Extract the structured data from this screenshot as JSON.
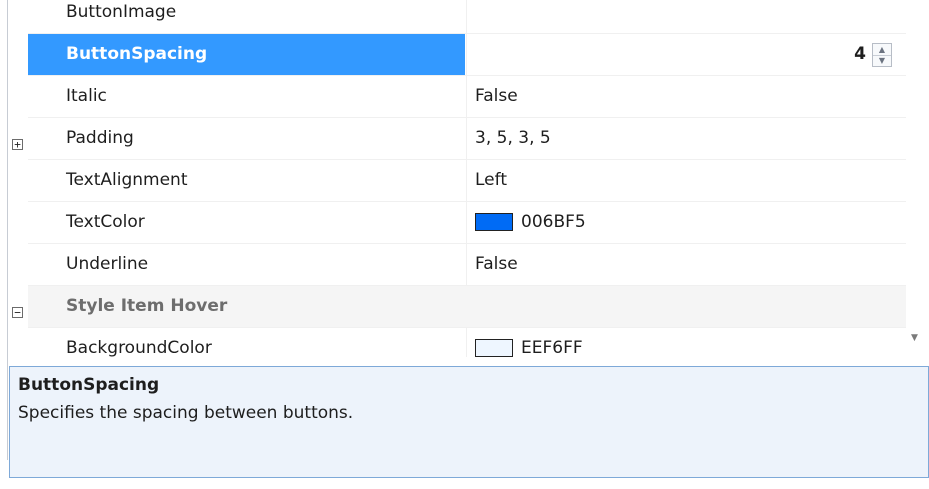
{
  "properties": {
    "rows": [
      {
        "name": "ButtonImage",
        "value": ""
      },
      {
        "name": "ButtonSpacing",
        "value": "4"
      },
      {
        "name": "Italic",
        "value": "False"
      },
      {
        "name": "Padding",
        "value": "3, 5, 3, 5"
      },
      {
        "name": "TextAlignment",
        "value": "Left"
      },
      {
        "name": "TextColor",
        "value": "006BF5",
        "swatch_color": "#006bf5"
      },
      {
        "name": "Underline",
        "value": "False"
      },
      {
        "name": "Style Item Hover",
        "value": ""
      },
      {
        "name": "BackgroundColor",
        "value": "EEF6FF",
        "swatch_color": "#eef6ff"
      }
    ],
    "selected_row": "ButtonSpacing",
    "expand_glyph": "⊞",
    "collapse_glyph": "⊟"
  },
  "description": {
    "title": "ButtonSpacing",
    "text": "Specifies the spacing between buttons."
  },
  "colors": {
    "selection": "#3399ff",
    "description_bg": "#edf3fb",
    "description_border": "#7ea9d8"
  }
}
